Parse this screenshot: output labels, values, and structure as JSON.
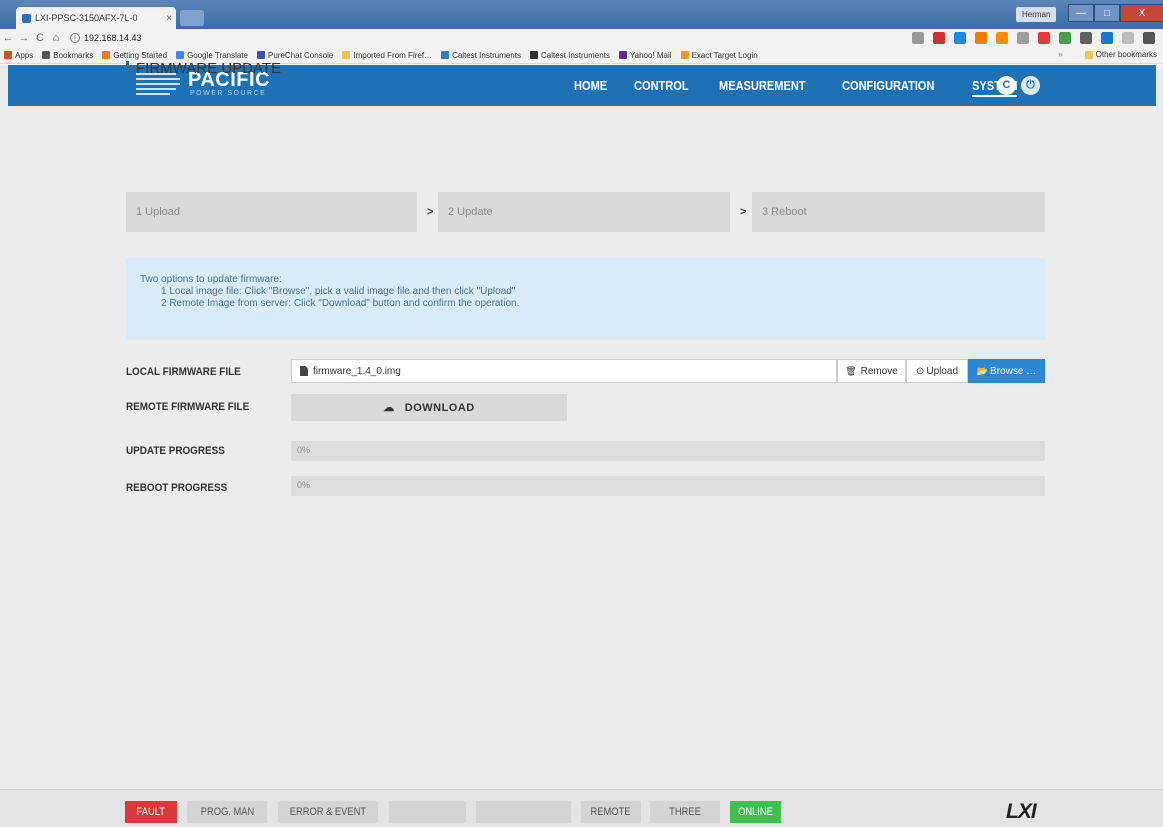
{
  "browser": {
    "tab_title": "LXI-PPSC-3150AFX-7L-0",
    "tab_close": "×",
    "url": "192.168.14.43",
    "user": "Herman",
    "win_min": "—",
    "win_max": "□",
    "win_close": "X",
    "nav_back": "←",
    "nav_forward": "→",
    "nav_reload": "C",
    "nav_home": "⌂",
    "info_glyph": "i",
    "bookmarks": [
      {
        "label": "Apps",
        "color": "#e64a19"
      },
      {
        "label": "Bookmarks",
        "color": "#555555"
      },
      {
        "label": "Getting Started",
        "color": "#f57c00"
      },
      {
        "label": "Google Translate",
        "color": "#4285f4"
      },
      {
        "label": "PureChat Console",
        "color": "#3f51b5"
      },
      {
        "label": "Imported From Firef…",
        "color": "#f3c54a"
      },
      {
        "label": "Caltest Instruments",
        "color": "#2d7cc1"
      },
      {
        "label": "Caltest Instruments",
        "color": "#333333"
      },
      {
        "label": "Yahoo! Mail",
        "color": "#5c2d91"
      },
      {
        "label": "Exact Target Login",
        "color": "#f39c12"
      }
    ],
    "more_bookmarks": "»",
    "other_bookmarks": "Other bookmarks",
    "extension_icons": [
      "star-icon",
      "acrobat-icon",
      "outlook-icon",
      "ext-orange-icon",
      "download-icon",
      "ext-grey-icon",
      "opera-icon",
      "ext-plus-icon",
      "ext-person-icon",
      "ext-badge-icon",
      "ext-square-icon",
      "menu-icon"
    ]
  },
  "header": {
    "logo_text": "PACIFIC",
    "logo_sub": "POWER SOURCE",
    "nav": [
      {
        "label": "HOME"
      },
      {
        "label": "CONTROL"
      },
      {
        "label": "MEASUREMENT"
      },
      {
        "label": "CONFIGURATION"
      },
      {
        "label": "SYSTEM",
        "active": true
      }
    ],
    "refresh_glyph": "C",
    "power_glyph": "⏻"
  },
  "page": {
    "title": "FIRMWARE UPDATE",
    "steps": [
      "1 Upload",
      "2 Update",
      "3 Reboot"
    ],
    "step_arrow": ">",
    "info_intro": "Two options to update firmware:",
    "info_option1": "1 Local image file: Click \"Browse\", pick a valid image file and then click \"Upload\"",
    "info_option2": "2 Remote Image from server: Click \"Download\" button and confirm the operation.",
    "local_label": "LOCAL FIRMWARE FILE",
    "local_file_value": "firmware_1.4_0.img",
    "remove_label": "Remove",
    "remove_icon": "🗑",
    "upload_label": "Upload",
    "upload_icon": "⊙",
    "browse_label": "Browse …",
    "browse_icon": "📂",
    "remote_label": "REMOTE FIRMWARE FILE",
    "download_label": "DOWNLOAD",
    "download_icon": "☁",
    "update_progress_label": "UPDATE PROGRESS",
    "update_progress_value": 0,
    "update_progress_text": "0%",
    "reboot_progress_label": "REBOOT PROGRESS",
    "reboot_progress_value": 0,
    "reboot_progress_text": "0%"
  },
  "statusbar": {
    "fault": "FAULT",
    "prog_man": "PROG. MAN",
    "error_event": "ERROR & EVENT",
    "remote": "REMOTE",
    "three_phase": "THREE PHASE",
    "online": "ONLINE",
    "lxi": "LXI"
  },
  "colors": {
    "brand_blue": "#1f71b5",
    "fault_red": "#d9383a",
    "online_green": "#3fbf4f",
    "browse_blue": "#2b87d8",
    "info_bg": "#d7ecf8"
  }
}
